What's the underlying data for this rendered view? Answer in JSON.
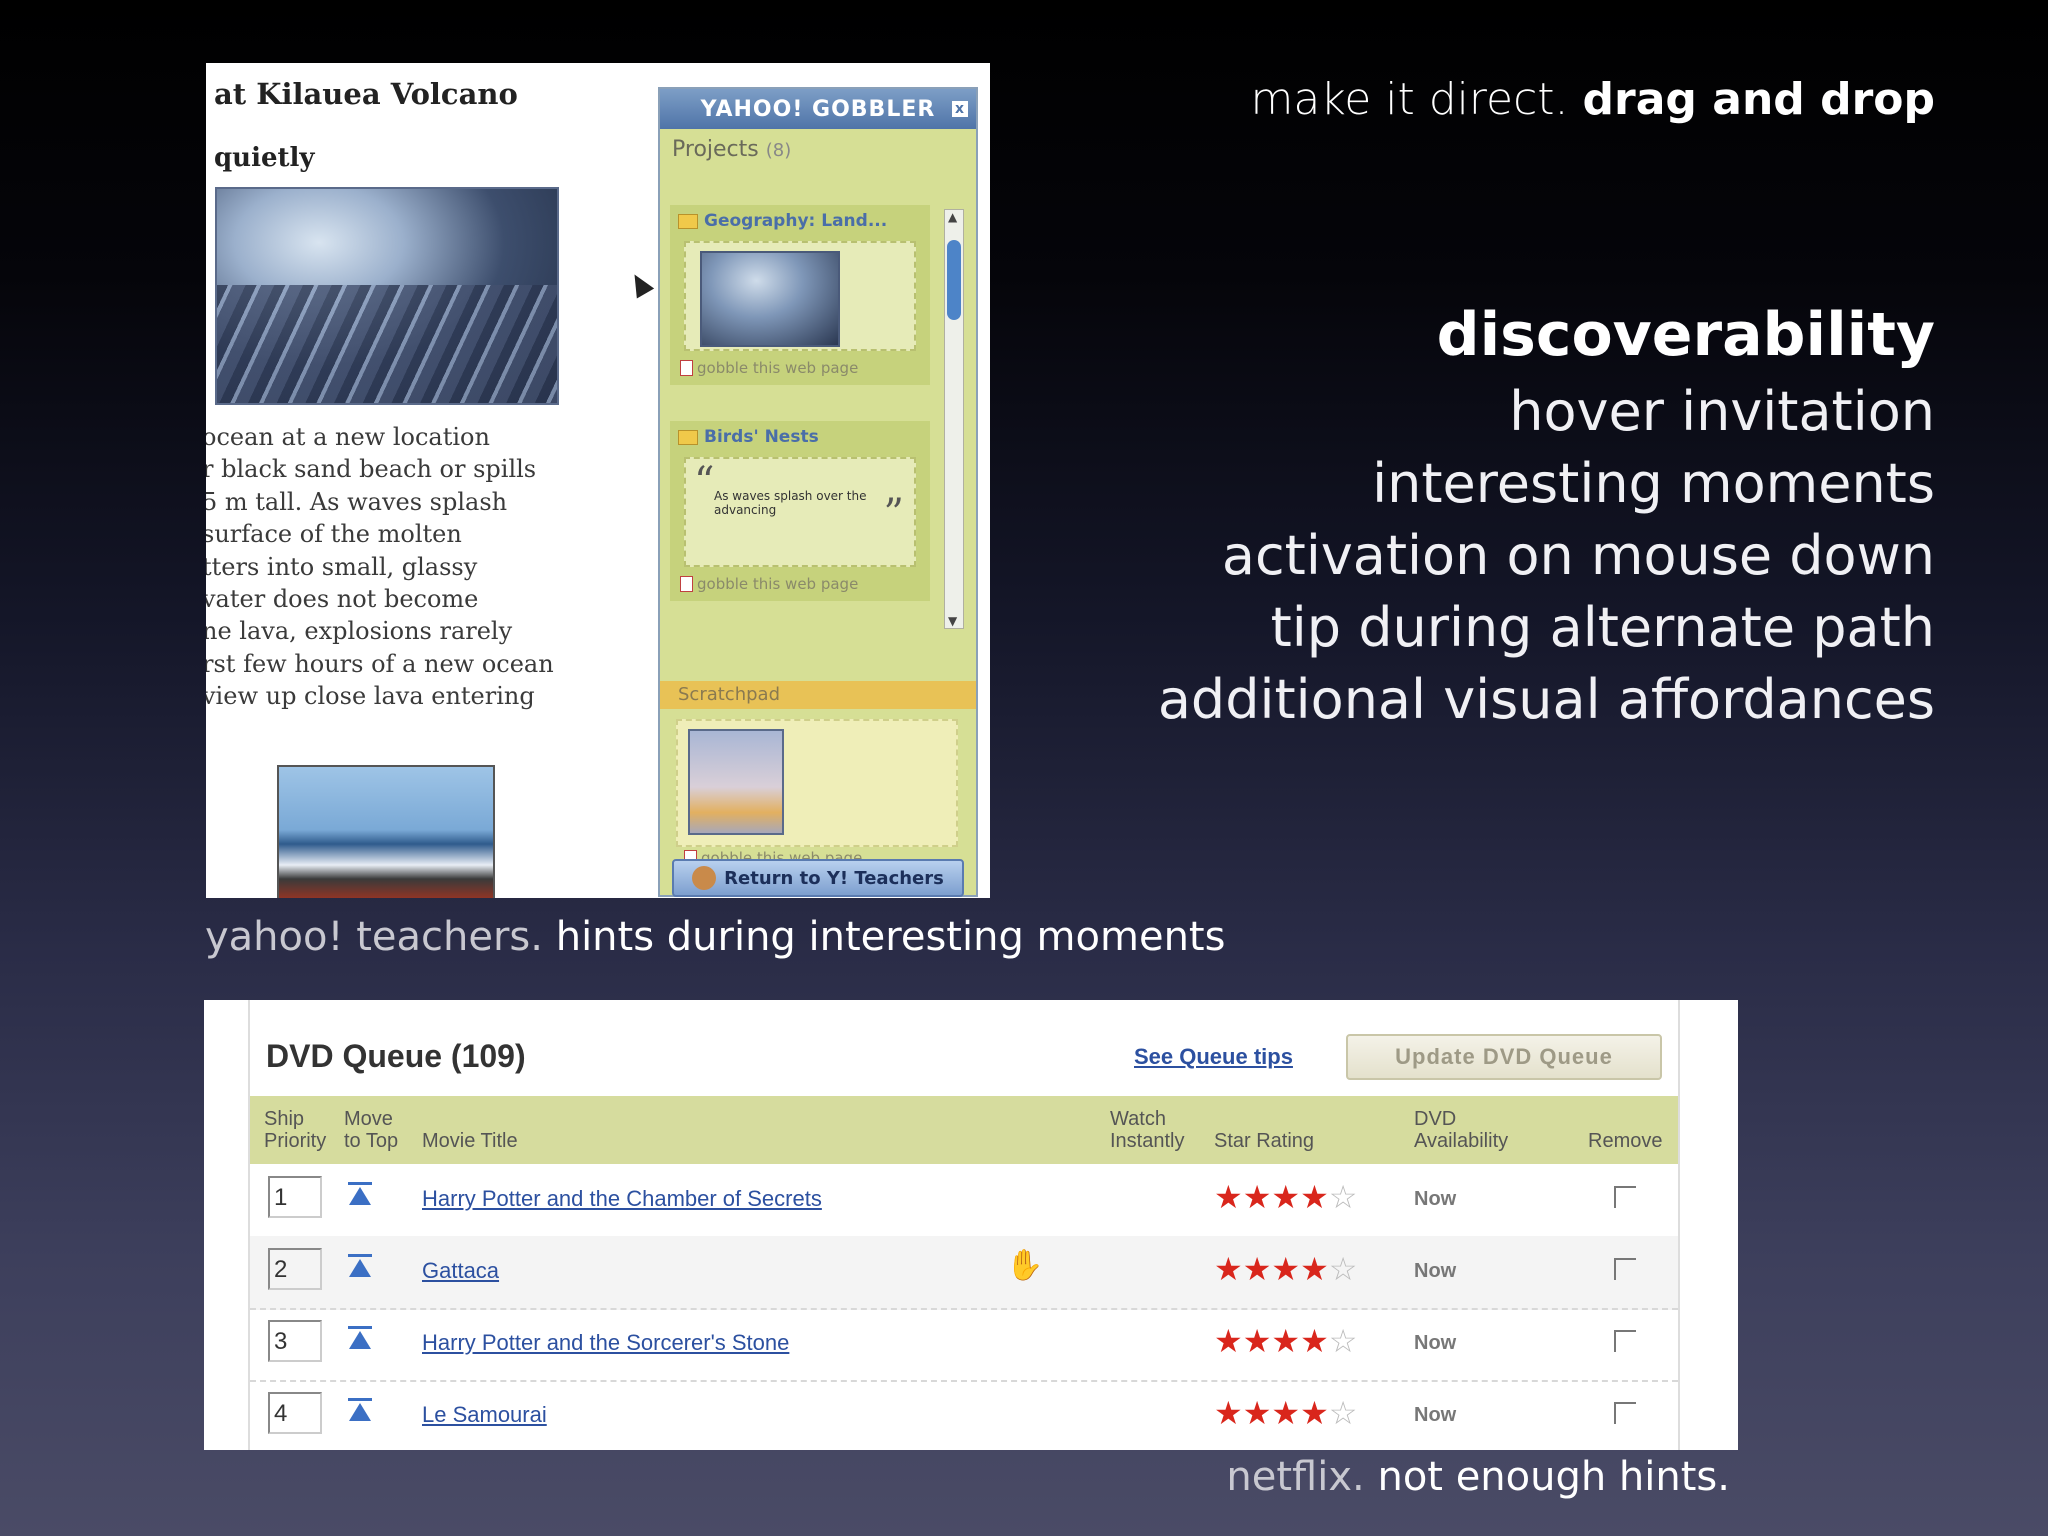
{
  "header": {
    "light": "make it direct.",
    "bold": "drag and drop"
  },
  "discoverability": {
    "title": "discoverability",
    "items": [
      "hover invitation",
      "interesting moments",
      "activation on mouse down",
      "tip during alternate path",
      "additional visual affordances"
    ]
  },
  "yahoo": {
    "caption_light": "yahoo! teachers.",
    "caption_bold": "hints during interesting moments",
    "article_title": "at Kilauea Volcano",
    "article_sub": "quietly",
    "article_lines": [
      "ocean at a new location",
      "r black sand beach or spills",
      "5 m tall. As waves splash",
      "surface of the molten",
      "tters into small, glassy",
      "vater does not become",
      "ne lava, explosions rarely",
      "rst few hours of a new ocean",
      "view up close lava entering"
    ],
    "gobbler": {
      "title": "YAHOO! GOBBLER",
      "close": "x",
      "projects_label": "Projects",
      "projects_count": "(8)",
      "project1_title": "Geography: Land...",
      "project2_title": "Birds' Nests",
      "quote_text": "As waves splash over the advancing",
      "gobble_link": "gobble this web page",
      "scratchpad_label": "Scratchpad",
      "return_button": "Return to Y! Teachers"
    }
  },
  "netflix": {
    "caption_light": "netflix.",
    "caption_bold": "not enough hints.",
    "title": "DVD Queue (109)",
    "tips_link": "See Queue tips",
    "update_button": "Update DVD Queue",
    "columns": {
      "ship_priority_1": "Ship",
      "ship_priority_2": "Priority",
      "move_top_1": "Move",
      "move_top_2": "to Top",
      "movie_title": "Movie Title",
      "watch_1": "Watch",
      "watch_2": "Instantly",
      "star_rating": "Star Rating",
      "dvd_avail_1": "DVD",
      "dvd_avail_2": "Availability",
      "remove": "Remove"
    },
    "rows": [
      {
        "priority": "1",
        "title": "Harry Potter and the Chamber of Secrets",
        "availability": "Now",
        "stars": 4
      },
      {
        "priority": "2",
        "title": "Gattaca",
        "availability": "Now",
        "stars": 3.5
      },
      {
        "priority": "3",
        "title": "Harry Potter and the Sorcerer's Stone",
        "availability": "Now",
        "stars": 4
      },
      {
        "priority": "4",
        "title": "Le Samourai",
        "availability": "Now",
        "stars": 4
      }
    ]
  }
}
